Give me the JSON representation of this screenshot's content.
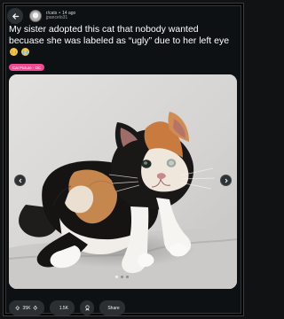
{
  "post": {
    "community": "r/cats",
    "time": "14 ago",
    "username": "jpancelo31",
    "title": "My sister adopted this cat that nobody wanted becuase she was labeled as “ugly” due to her left eye",
    "flair": "Cat Picture - OC"
  },
  "actions": {
    "upvotes": "35K",
    "comments": "1.5K",
    "share_label": "Share"
  },
  "image": {
    "description_icon": "calico-kitten-photo",
    "dots": 3,
    "active_dot": 1
  },
  "icons": {
    "back": "back-arrow-icon",
    "upvote": "upvote-icon",
    "downvote": "downvote-icon",
    "comment": "comment-icon",
    "award": "award-icon",
    "share": "share-icon"
  },
  "colors": {
    "flair": "#f04a93",
    "background": "#0e1113",
    "pill": "#2b2f31"
  }
}
